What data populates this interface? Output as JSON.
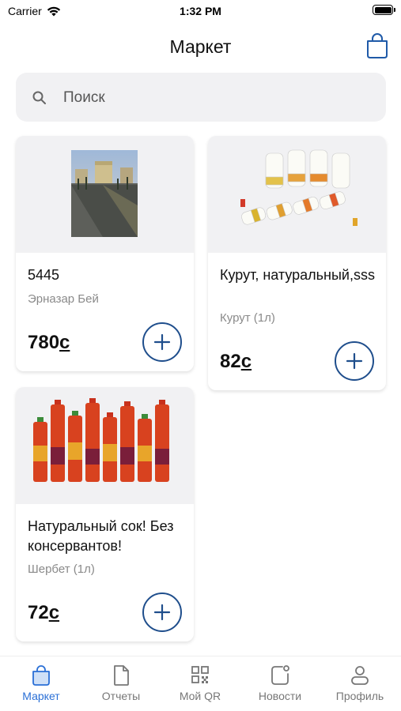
{
  "status_bar": {
    "carrier": "Carrier",
    "time": "1:32 PM"
  },
  "header": {
    "title": "Маркет"
  },
  "search": {
    "placeholder": "Поиск"
  },
  "products": [
    {
      "title": "5445",
      "subtitle": "Эрназар Бей",
      "price": "780",
      "currency": "c"
    },
    {
      "title": "Курут, натуральный,sss",
      "subtitle": "Курут (1л)",
      "price": "82",
      "currency": "c"
    },
    {
      "title": "Натуральный сок! Без консервантов!",
      "subtitle": "Шербет (1л)",
      "price": "72",
      "currency": "c"
    }
  ],
  "tabbar": {
    "items": [
      {
        "label": "Маркет",
        "icon": "bag-icon",
        "active": true
      },
      {
        "label": "Отчеты",
        "icon": "document-icon",
        "active": false
      },
      {
        "label": "Мой QR",
        "icon": "qr-icon",
        "active": false
      },
      {
        "label": "Новости",
        "icon": "news-icon",
        "active": false
      },
      {
        "label": "Профиль",
        "icon": "profile-icon",
        "active": false
      }
    ]
  },
  "colors": {
    "accent": "#2a6fd6",
    "button_border": "#1f4e8c",
    "card_media_bg": "#f1f1f3"
  }
}
